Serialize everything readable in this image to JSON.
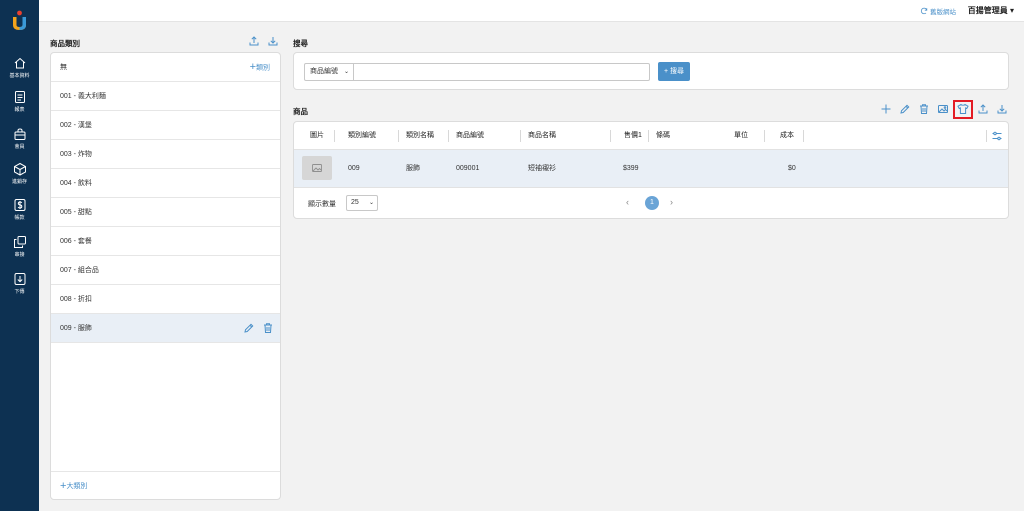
{
  "sidebar": {
    "items": [
      {
        "label": "基本資料",
        "icon": "home-icon"
      },
      {
        "label": "報表",
        "icon": "report-icon"
      },
      {
        "label": "會員",
        "icon": "member-icon"
      },
      {
        "label": "進銷存",
        "icon": "inventory-box-icon"
      },
      {
        "label": "帳款",
        "icon": "dollar-icon"
      },
      {
        "label": "串接",
        "icon": "integration-icon"
      },
      {
        "label": "下傳",
        "icon": "download-icon"
      }
    ]
  },
  "topbar": {
    "old_site": "舊版網站",
    "user": "百揚管理員 ▾"
  },
  "categories": {
    "title": "商品類別",
    "none_label": "無",
    "add_sub_label": "類別",
    "items": [
      "001 - 義大利麵",
      "002 - 漢堡",
      "003 - 炸物",
      "004 - 飲料",
      "005 - 甜點",
      "006 - 套餐",
      "007 - 組合品",
      "008 - 折扣",
      "009 - 服飾"
    ],
    "selected_index": 8,
    "add_major_label": "大類別"
  },
  "search": {
    "title": "搜尋",
    "field_select": "商品編號",
    "input_value": "",
    "button_label": "+ 搜尋"
  },
  "products": {
    "title": "商品",
    "columns": [
      "圖片",
      "類別編號",
      "類別名稱",
      "商品編號",
      "商品名稱",
      "售價1",
      "條碼",
      "單位",
      "成本"
    ],
    "rows": [
      {
        "image": "image-placeholder-icon",
        "category_code": "009",
        "category_name": "服飾",
        "product_code": "009001",
        "product_name": "短袖襯衫",
        "price1": "$399",
        "barcode": "",
        "unit": "",
        "cost": "$0"
      }
    ],
    "page_size_label": "顯示數量",
    "page_size": "25",
    "current_page": "1"
  },
  "colors": {
    "sidebar": "#0d3152",
    "accent": "#4a90c9",
    "highlight": "#e31b23",
    "selected_row": "#e9eff6"
  }
}
